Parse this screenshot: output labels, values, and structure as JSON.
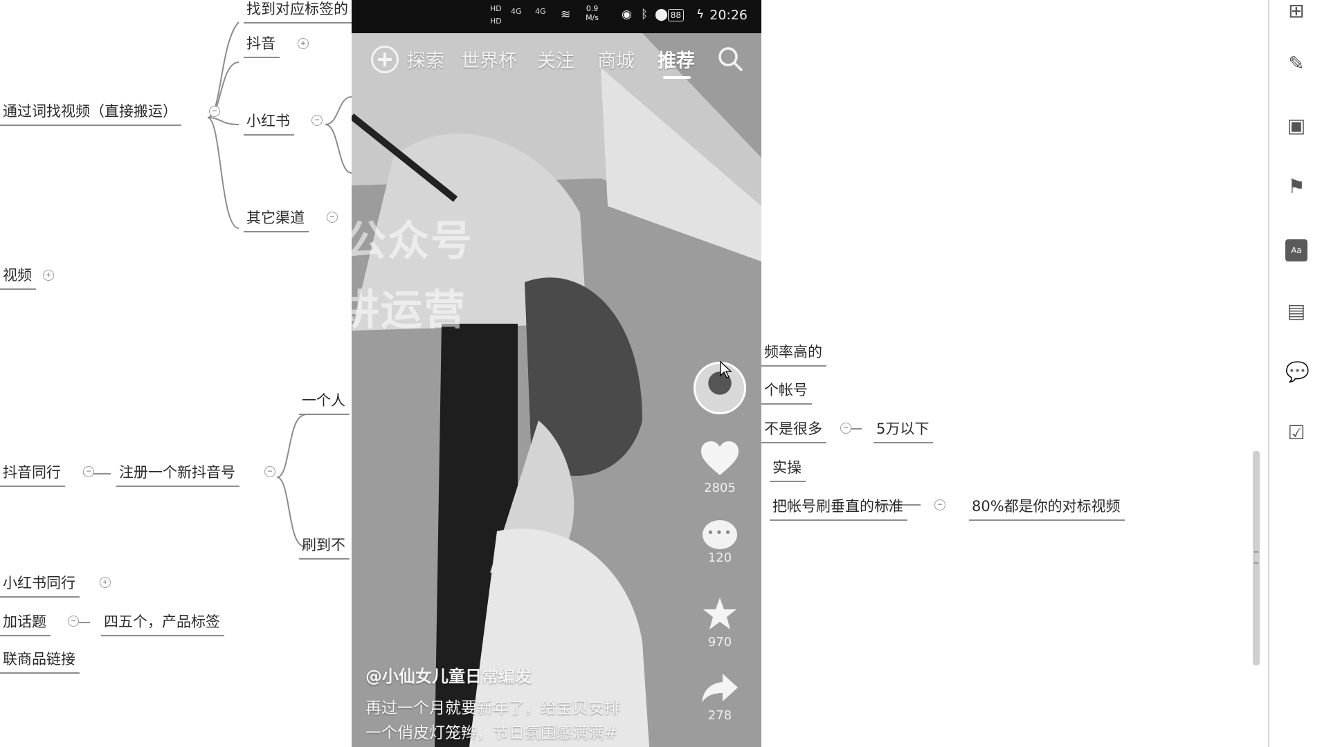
{
  "mindmap": {
    "nodes": [
      {
        "id": "n1",
        "text": "找到对应标签的"
      },
      {
        "id": "n2",
        "text": "抖音"
      },
      {
        "id": "n3",
        "text": "通过词找视频（直接搬运）"
      },
      {
        "id": "n4",
        "text": "小红书"
      },
      {
        "id": "n5",
        "text": "其它渠道"
      },
      {
        "id": "n6",
        "text": "视频"
      },
      {
        "id": "n7",
        "text": "一个人"
      },
      {
        "id": "n8",
        "text": "抖音同行"
      },
      {
        "id": "n9",
        "text": "注册一个新抖音号"
      },
      {
        "id": "n10",
        "text": "刷到不"
      },
      {
        "id": "n11",
        "text": "小红书同行"
      },
      {
        "id": "n12",
        "text": "加话题"
      },
      {
        "id": "n13",
        "text": "四五个，产品标签"
      },
      {
        "id": "n14",
        "text": "联商品链接"
      },
      {
        "id": "n15",
        "text": "频率高的"
      },
      {
        "id": "n16",
        "text": "个帐号"
      },
      {
        "id": "n17",
        "text": "不是很多"
      },
      {
        "id": "n18",
        "text": "5万以下"
      },
      {
        "id": "n19",
        "text": "实操"
      },
      {
        "id": "n20",
        "text": "把帐号刷垂直的标准"
      },
      {
        "id": "n21",
        "text": "80%都是你的对标视频"
      }
    ]
  },
  "phone": {
    "status": {
      "hd1": "HD",
      "hd2": "HD",
      "signal1": "4G",
      "signal2": "4G",
      "speed_value": "0.9",
      "speed_unit": "M/s",
      "battery": "88",
      "time": "20:26"
    },
    "tabs": [
      "探索",
      "世界杯",
      "关注",
      "商城",
      "推荐"
    ],
    "active_tab": "推荐",
    "watermark_line1": "公众号",
    "watermark_line2": "讲运营",
    "like_count": "2805",
    "comment_count": "120",
    "favorite_count": "970",
    "share_count": "278",
    "author": "@小仙女儿童日常编发",
    "caption_line1": "再过一个月就要新年了，给宝贝安排",
    "caption_line2": "一个俏皮灯笼辫，节日氛围感满满#"
  },
  "toolbar": {
    "icons": [
      "structure-icon",
      "brush-icon",
      "image-icon",
      "flag-icon",
      "text-style-icon",
      "note-icon",
      "comment-icon",
      "task-icon"
    ],
    "text_style_label": "Aa"
  }
}
